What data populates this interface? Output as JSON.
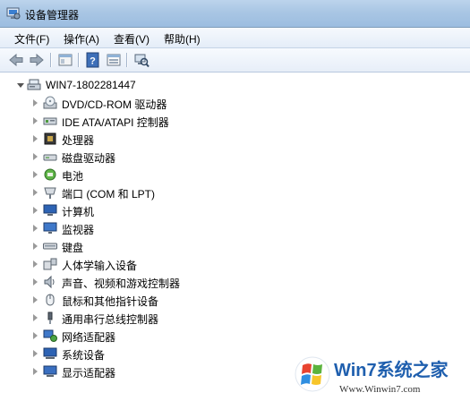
{
  "window": {
    "title": "设备管理器"
  },
  "menu": [
    {
      "label": "文件(F)"
    },
    {
      "label": "操作(A)"
    },
    {
      "label": "查看(V)"
    },
    {
      "label": "帮助(H)"
    }
  ],
  "toolbar": {
    "buttons": [
      "back-arrow-icon",
      "forward-arrow-icon",
      "properties-icon",
      "help-icon",
      "view-icon",
      "scan-hardware-icon"
    ]
  },
  "tree": {
    "root": {
      "label": "WIN7-1802281447",
      "icon": "computer-icon"
    },
    "items": [
      {
        "label": "DVD/CD-ROM 驱动器",
        "icon": "dvd-drive-icon"
      },
      {
        "label": "IDE ATA/ATAPI 控制器",
        "icon": "ide-controller-icon"
      },
      {
        "label": "处理器",
        "icon": "processor-icon"
      },
      {
        "label": "磁盘驱动器",
        "icon": "disk-drive-icon"
      },
      {
        "label": "电池",
        "icon": "battery-icon"
      },
      {
        "label": "端口 (COM 和 LPT)",
        "icon": "port-icon"
      },
      {
        "label": "计算机",
        "icon": "computer-monitor-icon"
      },
      {
        "label": "监视器",
        "icon": "monitor-icon"
      },
      {
        "label": "键盘",
        "icon": "keyboard-icon"
      },
      {
        "label": "人体学输入设备",
        "icon": "hid-icon"
      },
      {
        "label": "声音、视频和游戏控制器",
        "icon": "sound-icon"
      },
      {
        "label": "鼠标和其他指针设备",
        "icon": "mouse-icon"
      },
      {
        "label": "通用串行总线控制器",
        "icon": "usb-icon"
      },
      {
        "label": "网络适配器",
        "icon": "network-adapter-icon"
      },
      {
        "label": "系统设备",
        "icon": "system-devices-icon"
      },
      {
        "label": "显示适配器",
        "icon": "display-adapter-icon"
      }
    ]
  },
  "watermark": {
    "brand": "Win7系统之家",
    "url": "Www.Winwin7.com"
  }
}
